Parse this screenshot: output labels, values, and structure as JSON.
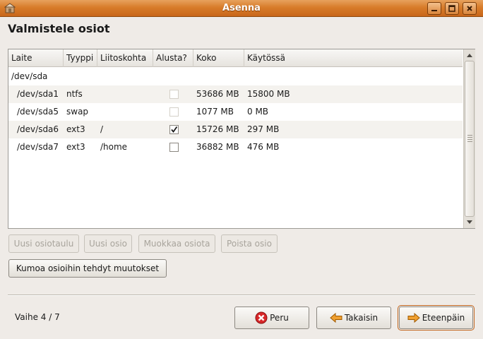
{
  "window": {
    "title": "Asenna"
  },
  "page": {
    "heading": "Valmistele osiot"
  },
  "table": {
    "columns": [
      "Laite",
      "Tyyppi",
      "Liitoskohta",
      "Alusta?",
      "Koko",
      "Käytössä"
    ],
    "rows": [
      {
        "device": "/dev/sda",
        "type": "",
        "mount": "",
        "format": null,
        "size": "",
        "used": ""
      },
      {
        "device": "/dev/sda1",
        "type": "ntfs",
        "mount": "",
        "format": "disabled",
        "size": "53686 MB",
        "used": "15800 MB"
      },
      {
        "device": "/dev/sda5",
        "type": "swap",
        "mount": "",
        "format": "disabled",
        "size": "1077 MB",
        "used": "0 MB"
      },
      {
        "device": "/dev/sda6",
        "type": "ext3",
        "mount": "/",
        "format": "checked",
        "size": "15726 MB",
        "used": "297 MB"
      },
      {
        "device": "/dev/sda7",
        "type": "ext3",
        "mount": "/home",
        "format": "unchecked",
        "size": "36882 MB",
        "used": "476 MB"
      }
    ]
  },
  "actions": {
    "new_table": "Uusi osiotaulu",
    "new_partition": "Uusi osio",
    "edit_partition": "Muokkaa osiota",
    "delete_partition": "Poista osio",
    "undo": "Kumoa osioihin tehdyt muutokset"
  },
  "footer": {
    "step": "Vaihe 4 / 7",
    "cancel": "Peru",
    "back": "Takaisin",
    "forward": "Eteenpäin"
  },
  "colors": {
    "titlebar": "#d87c2a",
    "accent": "#e0701b"
  }
}
